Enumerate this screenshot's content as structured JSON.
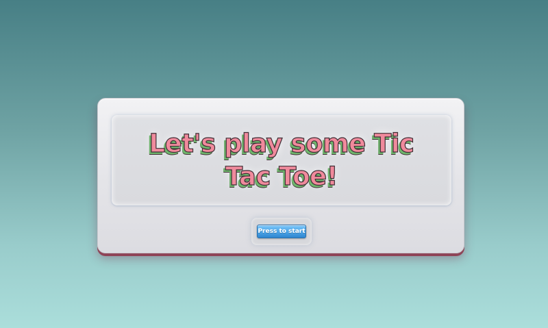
{
  "game": {
    "title": "Let's play some Tic Tac Toe!",
    "start_button_label": "Press to start"
  },
  "colors": {
    "title_fill": "#f08a9c",
    "title_shadow": "#6fb56c",
    "button": "#4fa6e8",
    "card_shadow": "#8f4457"
  }
}
